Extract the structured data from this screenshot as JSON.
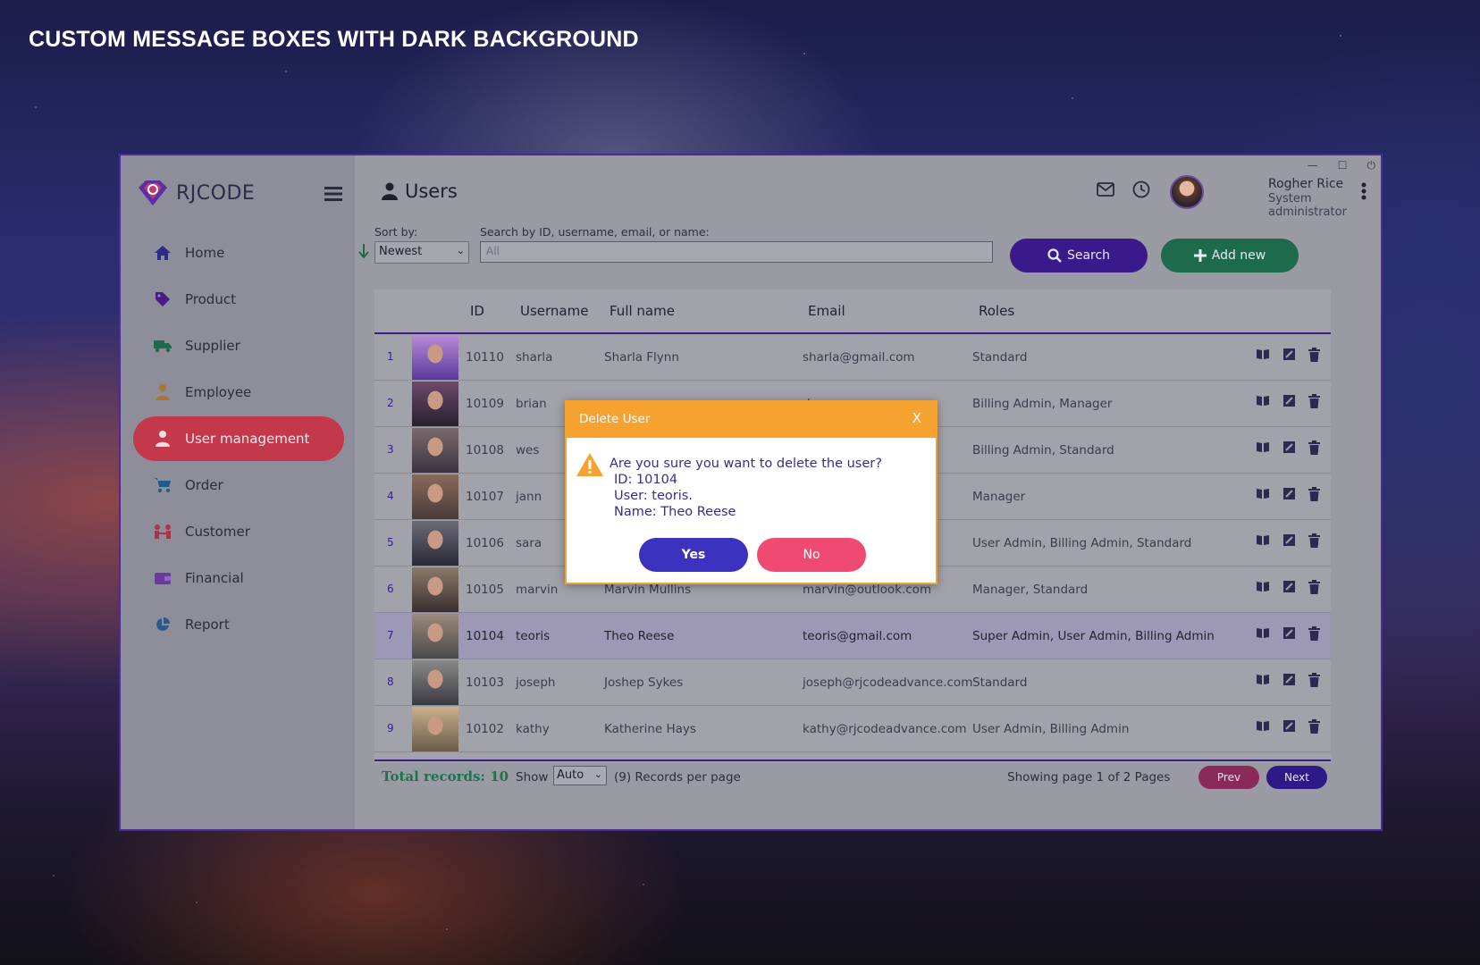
{
  "banner": "CUSTOM MESSAGE BOXES WITH DARK BACKGROUND",
  "app": {
    "logo_text": "RJCODE"
  },
  "sidebar": {
    "items": [
      {
        "label": "Home",
        "icon": "home-icon"
      },
      {
        "label": "Product",
        "icon": "tag-icon"
      },
      {
        "label": "Supplier",
        "icon": "truck-icon"
      },
      {
        "label": "Employee",
        "icon": "employee-icon"
      },
      {
        "label": "User management",
        "icon": "user-icon",
        "active": true
      },
      {
        "label": "Order",
        "icon": "cart-icon"
      },
      {
        "label": "Customer",
        "icon": "customer-icon"
      },
      {
        "label": "Financial",
        "icon": "wallet-icon"
      },
      {
        "label": "Report",
        "icon": "pie-chart-icon"
      }
    ]
  },
  "header": {
    "title": "Users",
    "user_name": "Rogher Rice",
    "user_role": "System administrator"
  },
  "toolbar": {
    "sort_label": "Sort by:",
    "sort_value": "Newest",
    "search_label": "Search by ID, username, email, or name:",
    "search_value": "All",
    "search_button": "Search",
    "add_button": "Add new"
  },
  "table": {
    "columns": [
      "ID",
      "Username",
      "Full name",
      "Email",
      "Roles"
    ],
    "rows": [
      {
        "n": "1",
        "id": "10110",
        "username": "sharla",
        "name": "Sharla Flynn",
        "email": "sharla@gmail.com",
        "roles": "Standard"
      },
      {
        "n": "2",
        "id": "10109",
        "username": "brian",
        "name": "",
        "email": "dvance.com",
        "roles": "Billing Admin, Manager"
      },
      {
        "n": "3",
        "id": "10108",
        "username": "wes",
        "name": "",
        "email": ".com",
        "roles": "Billing Admin, Standard"
      },
      {
        "n": "4",
        "id": "10107",
        "username": "jann",
        "name": "",
        "email": "com",
        "roles": "Manager"
      },
      {
        "n": "5",
        "id": "10106",
        "username": "sara",
        "name": "",
        "email": "vance.com",
        "roles": "User Admin, Billing Admin, Standard"
      },
      {
        "n": "6",
        "id": "10105",
        "username": "marvin",
        "name": "Marvin Mullins",
        "email": "marvin@outlook.com",
        "roles": "Manager, Standard"
      },
      {
        "n": "7",
        "id": "10104",
        "username": "teoris",
        "name": "Theo Reese",
        "email": "teoris@gmail.com",
        "roles": "Super Admin, User Admin, Billing Admin",
        "selected": true
      },
      {
        "n": "8",
        "id": "10103",
        "username": "joseph",
        "name": "Joshep Sykes",
        "email": "joseph@rjcodeadvance.com",
        "roles": "Standard"
      },
      {
        "n": "9",
        "id": "10102",
        "username": "kathy",
        "name": "Katherine Hays",
        "email": "kathy@rjcodeadvance.com",
        "roles": "User Admin, Billing Admin"
      }
    ]
  },
  "footer": {
    "total": "Total records: 10",
    "show_label": "Show",
    "show_value": "Auto",
    "per_page": "(9) Records per page",
    "pages": "Showing page 1 of 2 Pages",
    "prev": "Prev",
    "next": "Next"
  },
  "dialog": {
    "title": "Delete User",
    "close": "X",
    "question": "Are you sure you want to delete the user?",
    "line_id": "ID: 10104",
    "line_user": "User: teoris.",
    "line_name": "Name: Theo Reese",
    "yes": "Yes",
    "no": "No"
  },
  "colors": {
    "accent": "#3b1e86",
    "active_nav": "#c4384c",
    "dialog_header": "#f5a231",
    "yes_button": "#3b33c0",
    "no_button": "#ee4a72",
    "add_button": "#1d6a4d"
  }
}
